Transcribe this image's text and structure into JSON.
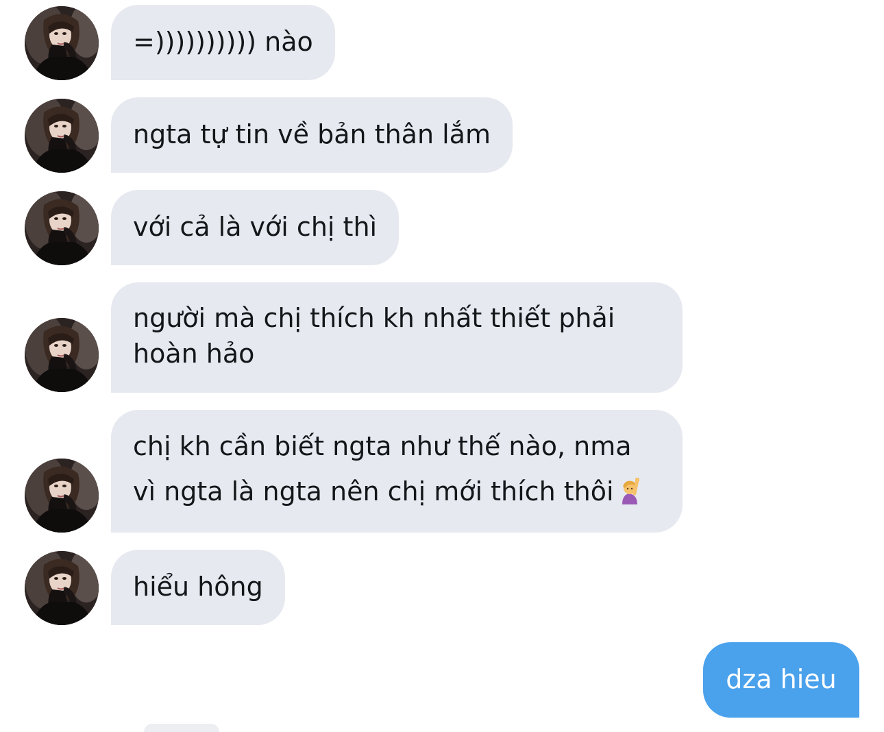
{
  "conversation": {
    "messages": [
      {
        "sender": "contact",
        "text": "=)))))))))) nào"
      },
      {
        "sender": "contact",
        "text": "ngta tự tin về bản thân lắm"
      },
      {
        "sender": "contact",
        "text": "với cả là với chị thì"
      },
      {
        "sender": "contact",
        "lines": [
          "người mà chị thích kh nhất thiết phải",
          "hoàn hảo"
        ]
      },
      {
        "sender": "contact",
        "lines": [
          "chị kh cần biết ngta như thế nào, nma",
          "vì ngta là ngta nên chị mới thích thôi"
        ],
        "emoji": "person-raising-hand-emoji"
      },
      {
        "sender": "contact",
        "text": "hiểu hông"
      },
      {
        "sender": "me",
        "text": "dza hieu"
      }
    ]
  },
  "colors": {
    "incoming_bubble": "#e6e9ef",
    "outgoing_bubble": "#4aa1ec",
    "incoming_text": "#14171a",
    "outgoing_text": "#ffffff",
    "background": "#ffffff"
  },
  "icons": {
    "avatar": "contact-avatar-photo",
    "emoji": "person-raising-hand-emoji"
  }
}
